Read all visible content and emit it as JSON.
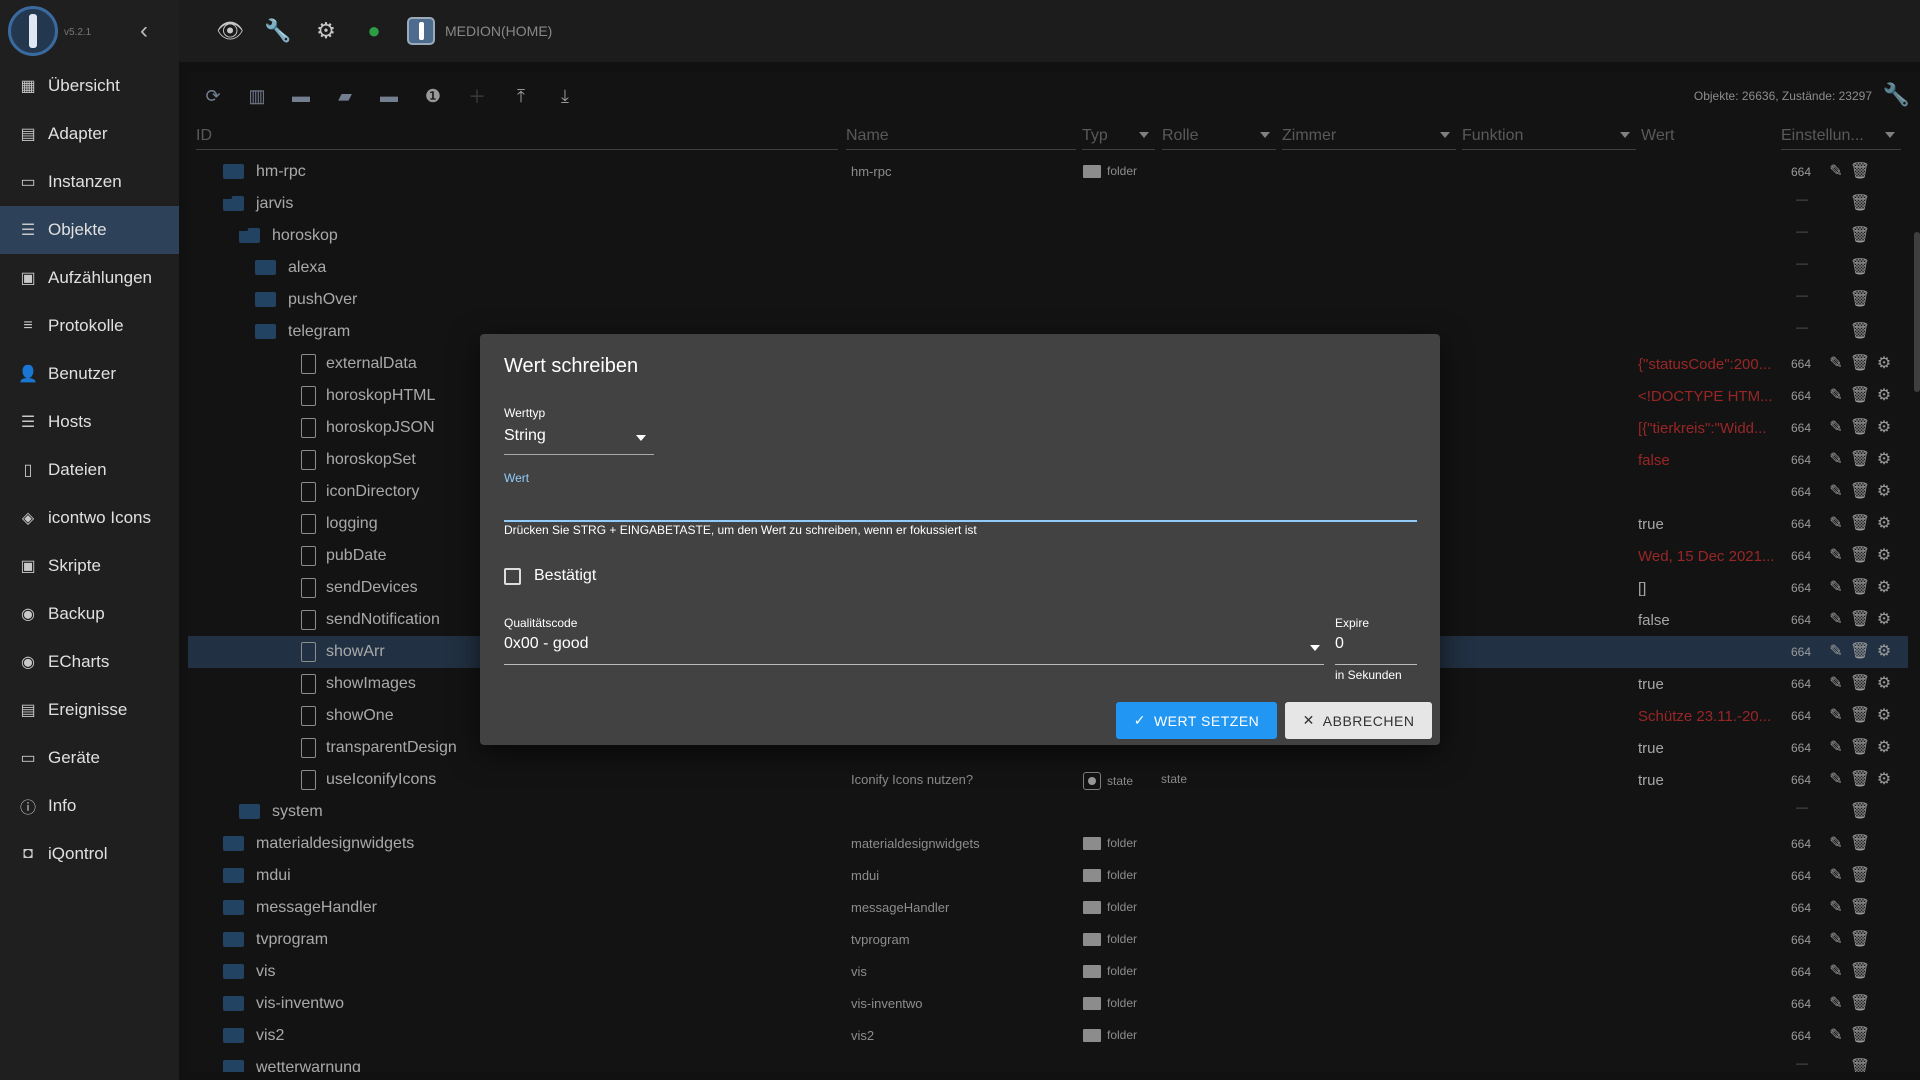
{
  "app": {
    "version": "v5.2.1",
    "host": "MEDION(HOME)"
  },
  "sidebar": {
    "items": [
      {
        "label": "Übersicht",
        "icon": "grid-icon"
      },
      {
        "label": "Adapter",
        "icon": "store-icon"
      },
      {
        "label": "Instanzen",
        "icon": "instances-icon"
      },
      {
        "label": "Objekte",
        "icon": "list-icon",
        "active": true
      },
      {
        "label": "Aufzählungen",
        "icon": "enum-icon"
      },
      {
        "label": "Protokolle",
        "icon": "log-icon"
      },
      {
        "label": "Benutzer",
        "icon": "user-icon"
      },
      {
        "label": "Hosts",
        "icon": "hosts-icon"
      },
      {
        "label": "Dateien",
        "icon": "files-icon"
      },
      {
        "label": "icontwo Icons",
        "icon": "icontwo-icon"
      },
      {
        "label": "Skripte",
        "icon": "script-icon"
      },
      {
        "label": "Backup",
        "icon": "backup-icon"
      },
      {
        "label": "ECharts",
        "icon": "echarts-icon"
      },
      {
        "label": "Ereignisse",
        "icon": "events-icon"
      },
      {
        "label": "Geräte",
        "icon": "devices-icon"
      },
      {
        "label": "Info",
        "icon": "info-icon"
      },
      {
        "label": "iQontrol",
        "icon": "iqontrol-icon"
      }
    ]
  },
  "objects": {
    "counts": "Objekte: 26636, Zustände: 23297",
    "columns": {
      "id": "ID",
      "name": "Name",
      "type": "Typ",
      "role": "Rolle",
      "room": "Zimmer",
      "function": "Funktion",
      "value": "Wert",
      "settings": "Einstellun..."
    },
    "rows": [
      {
        "id": "hm-rpc",
        "level": 0,
        "kind": "folder",
        "name": "hm-rpc",
        "type": "folder",
        "num": "664"
      },
      {
        "id": "jarvis",
        "level": 0,
        "kind": "open",
        "dash": "—"
      },
      {
        "id": "horoskop",
        "level": 1,
        "kind": "open",
        "dash": "—"
      },
      {
        "id": "alexa",
        "level": 2,
        "kind": "folder",
        "dash": "—"
      },
      {
        "id": "pushOver",
        "level": 2,
        "kind": "folder",
        "dash": "—"
      },
      {
        "id": "telegram",
        "level": 2,
        "kind": "folder",
        "dash": "—"
      },
      {
        "id": "externalData",
        "level": 2,
        "kind": "file",
        "value": "{\"statusCode\":200...",
        "red": true,
        "num": "664"
      },
      {
        "id": "horoskopHTML",
        "level": 2,
        "kind": "file",
        "value": "<!DOCTYPE HTM...",
        "red": true,
        "num": "664"
      },
      {
        "id": "horoskopJSON",
        "level": 2,
        "kind": "file",
        "value": "[{\"tierkreis\":\"Widd...",
        "red": true,
        "num": "664"
      },
      {
        "id": "horoskopSet",
        "level": 2,
        "kind": "file",
        "value": "false",
        "red": true,
        "num": "664"
      },
      {
        "id": "iconDirectory",
        "level": 2,
        "kind": "file",
        "num": "664"
      },
      {
        "id": "logging",
        "level": 2,
        "kind": "file",
        "value": "true",
        "num": "664"
      },
      {
        "id": "pubDate",
        "level": 2,
        "kind": "file",
        "value": "Wed, 15 Dec 2021...",
        "red": true,
        "num": "664"
      },
      {
        "id": "sendDevices",
        "level": 2,
        "kind": "file",
        "value": "[]",
        "num": "664"
      },
      {
        "id": "sendNotification",
        "level": 2,
        "kind": "file",
        "value": "false",
        "num": "664"
      },
      {
        "id": "showArr",
        "level": 2,
        "kind": "file",
        "num": "664",
        "selected": true
      },
      {
        "id": "showImages",
        "level": 2,
        "kind": "file",
        "value": "true",
        "num": "664"
      },
      {
        "id": "showOne",
        "level": 2,
        "kind": "file",
        "value": "Schütze 23.11.-20...",
        "red": true,
        "num": "664"
      },
      {
        "id": "transparentDesign",
        "level": 2,
        "kind": "file",
        "value": "true",
        "num": "664"
      },
      {
        "id": "useIconifyIcons",
        "level": 2,
        "kind": "file",
        "name": "Iconify Icons nutzen?",
        "type": "state",
        "role": "state",
        "value": "true",
        "num": "664"
      },
      {
        "id": "system",
        "level": 1,
        "kind": "folder",
        "dash": "—"
      },
      {
        "id": "materialdesignwidgets",
        "level": 0,
        "kind": "folder",
        "name": "materialdesignwidgets",
        "type": "folder",
        "num": "664"
      },
      {
        "id": "mdui",
        "level": 0,
        "kind": "folder",
        "name": "mdui",
        "type": "folder",
        "num": "664"
      },
      {
        "id": "messageHandler",
        "level": 0,
        "kind": "folder",
        "name": "messageHandler",
        "type": "folder",
        "num": "664"
      },
      {
        "id": "tvprogram",
        "level": 0,
        "kind": "folder",
        "name": "tvprogram",
        "type": "folder",
        "num": "664"
      },
      {
        "id": "vis",
        "level": 0,
        "kind": "folder",
        "name": "vis",
        "type": "folder",
        "num": "664"
      },
      {
        "id": "vis-inventwo",
        "level": 0,
        "kind": "folder",
        "name": "vis-inventwo",
        "type": "folder",
        "num": "664"
      },
      {
        "id": "vis2",
        "level": 0,
        "kind": "folder",
        "name": "vis2",
        "type": "folder",
        "num": "664"
      },
      {
        "id": "wetterwarnung",
        "level": 0,
        "kind": "folder",
        "dash": "—"
      }
    ]
  },
  "dialog": {
    "title": "Wert schreiben",
    "werttyp_label": "Werttyp",
    "werttyp_value": "String",
    "wert_label": "Wert",
    "wert_value": "",
    "hint": "Drücken Sie STRG + EINGABETASTE, um den Wert zu schreiben, wenn er fokussiert ist",
    "ack_label": "Bestätigt",
    "quality_label": "Qualitätscode",
    "quality_value": "0x00 - good",
    "expire_label": "Expire",
    "expire_value": "0",
    "expire_unit": "in Sekunden",
    "ok_label": "WERT SETZEN",
    "cancel_label": "ABBRECHEN"
  },
  "colors": {
    "accent": "#2196f3",
    "active_nav": "#2d4158",
    "error_value": "#cc3333"
  }
}
